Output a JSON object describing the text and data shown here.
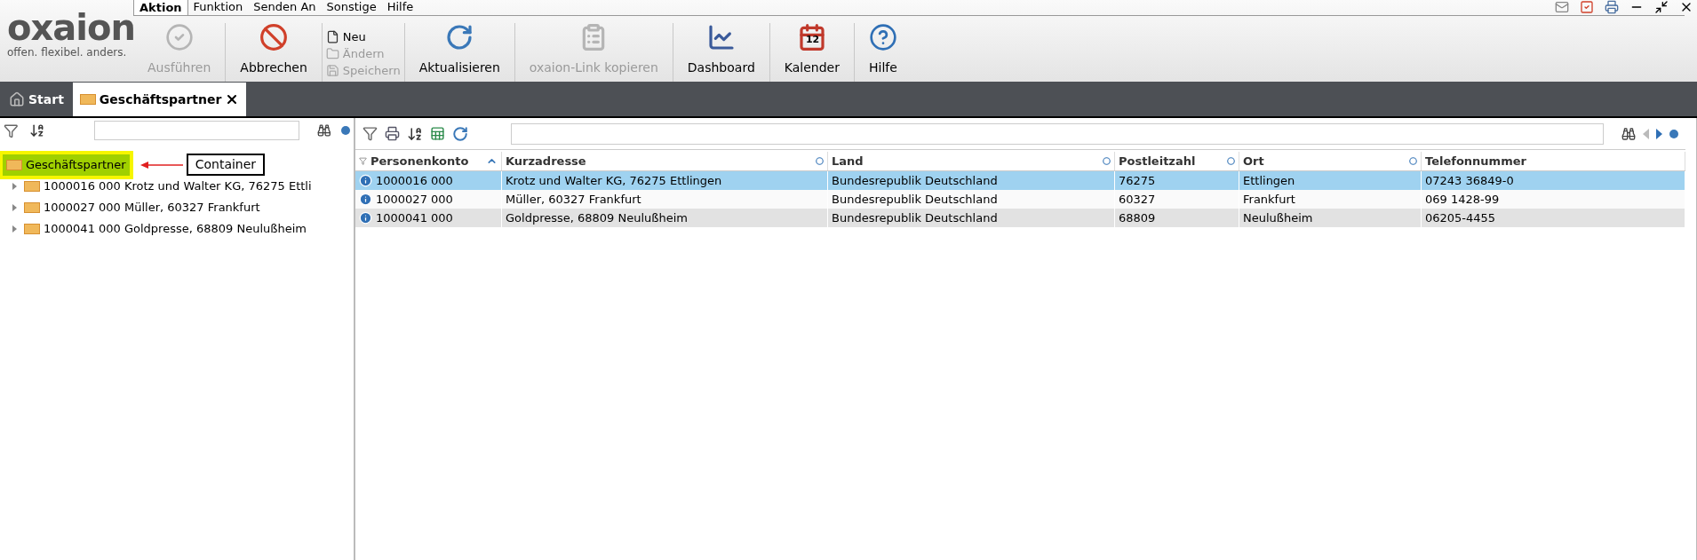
{
  "logo": {
    "name": "oxaion",
    "slogan": "offen. flexibel. anders."
  },
  "menu": [
    {
      "label": "Aktion",
      "selected": true
    },
    {
      "label": "Funktion",
      "selected": false
    },
    {
      "label": "Senden An",
      "selected": false
    },
    {
      "label": "Sonstige",
      "selected": false
    },
    {
      "label": "Hilfe",
      "selected": false
    }
  ],
  "toolbar": [
    {
      "kind": "big",
      "label": "Ausführen",
      "disabled": true
    },
    {
      "kind": "big",
      "label": "Abbrechen",
      "disabled": false
    },
    {
      "kind": "stack",
      "items": [
        {
          "label": "Neu",
          "disabled": false
        },
        {
          "label": "Ändern",
          "disabled": true
        },
        {
          "label": "Speichern",
          "disabled": true
        }
      ]
    },
    {
      "kind": "big",
      "label": "Aktualisieren",
      "disabled": false
    },
    {
      "kind": "big",
      "label": "oxaion-Link kopieren",
      "disabled": true
    },
    {
      "kind": "big",
      "label": "Dashboard",
      "disabled": false
    },
    {
      "kind": "big",
      "label": "Kalender",
      "disabled": false,
      "badge": "12"
    },
    {
      "kind": "big",
      "label": "Hilfe",
      "disabled": false
    }
  ],
  "tabs": [
    {
      "label": "Start",
      "selected": false,
      "closable": false
    },
    {
      "label": "Geschäftspartner",
      "selected": true,
      "closable": true
    }
  ],
  "tree": {
    "root": {
      "label": "Geschäftspartner",
      "selected": true
    },
    "annotation": "Container",
    "children": [
      {
        "label": "1000016 000 Krotz und Walter KG, 76275 Ettli",
        "selected": false
      },
      {
        "label": "1000027 000 Müller, 60327 Frankfurt",
        "selected": false
      },
      {
        "label": "1000041 000 Goldpresse, 68809 Neulußheim",
        "selected": false
      }
    ]
  },
  "table": {
    "columns": [
      "Personenkonto",
      "Kurzadresse",
      "Land",
      "Postleitzahl",
      "Ort",
      "Telefonnummer"
    ],
    "rows": [
      {
        "selected": true,
        "cells": [
          "1000016 000",
          "Krotz und Walter KG, 76275 Ettlingen",
          "Bundesrepublik Deutschland",
          "76275",
          "Ettlingen",
          "07243 36849-0"
        ]
      },
      {
        "selected": false,
        "cells": [
          "1000027 000",
          "Müller, 60327 Frankfurt",
          "Bundesrepublik Deutschland",
          "60327",
          "Frankfurt",
          "069 1428-99"
        ]
      },
      {
        "selected": false,
        "cells": [
          "1000041 000",
          "Goldpresse, 68809 Neulußheim",
          "Bundesrepublik Deutschland",
          "68809",
          "Neulußheim",
          "06205-4455"
        ]
      }
    ]
  }
}
